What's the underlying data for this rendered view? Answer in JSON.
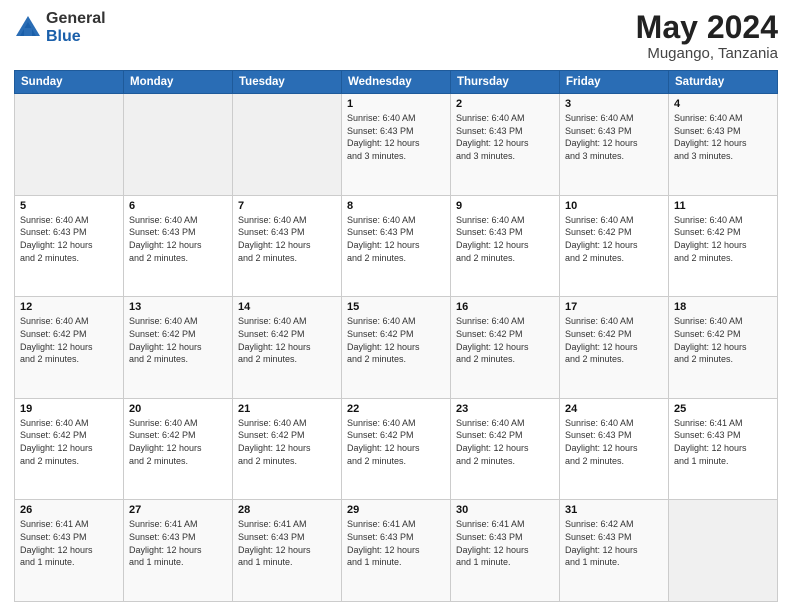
{
  "header": {
    "logo_general": "General",
    "logo_blue": "Blue",
    "month_title": "May 2024",
    "location": "Mugango, Tanzania"
  },
  "days_of_week": [
    "Sunday",
    "Monday",
    "Tuesday",
    "Wednesday",
    "Thursday",
    "Friday",
    "Saturday"
  ],
  "weeks": [
    [
      {
        "num": "",
        "info": ""
      },
      {
        "num": "",
        "info": ""
      },
      {
        "num": "",
        "info": ""
      },
      {
        "num": "1",
        "info": "Sunrise: 6:40 AM\nSunset: 6:43 PM\nDaylight: 12 hours\nand 3 minutes."
      },
      {
        "num": "2",
        "info": "Sunrise: 6:40 AM\nSunset: 6:43 PM\nDaylight: 12 hours\nand 3 minutes."
      },
      {
        "num": "3",
        "info": "Sunrise: 6:40 AM\nSunset: 6:43 PM\nDaylight: 12 hours\nand 3 minutes."
      },
      {
        "num": "4",
        "info": "Sunrise: 6:40 AM\nSunset: 6:43 PM\nDaylight: 12 hours\nand 3 minutes."
      }
    ],
    [
      {
        "num": "5",
        "info": "Sunrise: 6:40 AM\nSunset: 6:43 PM\nDaylight: 12 hours\nand 2 minutes."
      },
      {
        "num": "6",
        "info": "Sunrise: 6:40 AM\nSunset: 6:43 PM\nDaylight: 12 hours\nand 2 minutes."
      },
      {
        "num": "7",
        "info": "Sunrise: 6:40 AM\nSunset: 6:43 PM\nDaylight: 12 hours\nand 2 minutes."
      },
      {
        "num": "8",
        "info": "Sunrise: 6:40 AM\nSunset: 6:43 PM\nDaylight: 12 hours\nand 2 minutes."
      },
      {
        "num": "9",
        "info": "Sunrise: 6:40 AM\nSunset: 6:43 PM\nDaylight: 12 hours\nand 2 minutes."
      },
      {
        "num": "10",
        "info": "Sunrise: 6:40 AM\nSunset: 6:42 PM\nDaylight: 12 hours\nand 2 minutes."
      },
      {
        "num": "11",
        "info": "Sunrise: 6:40 AM\nSunset: 6:42 PM\nDaylight: 12 hours\nand 2 minutes."
      }
    ],
    [
      {
        "num": "12",
        "info": "Sunrise: 6:40 AM\nSunset: 6:42 PM\nDaylight: 12 hours\nand 2 minutes."
      },
      {
        "num": "13",
        "info": "Sunrise: 6:40 AM\nSunset: 6:42 PM\nDaylight: 12 hours\nand 2 minutes."
      },
      {
        "num": "14",
        "info": "Sunrise: 6:40 AM\nSunset: 6:42 PM\nDaylight: 12 hours\nand 2 minutes."
      },
      {
        "num": "15",
        "info": "Sunrise: 6:40 AM\nSunset: 6:42 PM\nDaylight: 12 hours\nand 2 minutes."
      },
      {
        "num": "16",
        "info": "Sunrise: 6:40 AM\nSunset: 6:42 PM\nDaylight: 12 hours\nand 2 minutes."
      },
      {
        "num": "17",
        "info": "Sunrise: 6:40 AM\nSunset: 6:42 PM\nDaylight: 12 hours\nand 2 minutes."
      },
      {
        "num": "18",
        "info": "Sunrise: 6:40 AM\nSunset: 6:42 PM\nDaylight: 12 hours\nand 2 minutes."
      }
    ],
    [
      {
        "num": "19",
        "info": "Sunrise: 6:40 AM\nSunset: 6:42 PM\nDaylight: 12 hours\nand 2 minutes."
      },
      {
        "num": "20",
        "info": "Sunrise: 6:40 AM\nSunset: 6:42 PM\nDaylight: 12 hours\nand 2 minutes."
      },
      {
        "num": "21",
        "info": "Sunrise: 6:40 AM\nSunset: 6:42 PM\nDaylight: 12 hours\nand 2 minutes."
      },
      {
        "num": "22",
        "info": "Sunrise: 6:40 AM\nSunset: 6:42 PM\nDaylight: 12 hours\nand 2 minutes."
      },
      {
        "num": "23",
        "info": "Sunrise: 6:40 AM\nSunset: 6:42 PM\nDaylight: 12 hours\nand 2 minutes."
      },
      {
        "num": "24",
        "info": "Sunrise: 6:40 AM\nSunset: 6:43 PM\nDaylight: 12 hours\nand 2 minutes."
      },
      {
        "num": "25",
        "info": "Sunrise: 6:41 AM\nSunset: 6:43 PM\nDaylight: 12 hours\nand 1 minute."
      }
    ],
    [
      {
        "num": "26",
        "info": "Sunrise: 6:41 AM\nSunset: 6:43 PM\nDaylight: 12 hours\nand 1 minute."
      },
      {
        "num": "27",
        "info": "Sunrise: 6:41 AM\nSunset: 6:43 PM\nDaylight: 12 hours\nand 1 minute."
      },
      {
        "num": "28",
        "info": "Sunrise: 6:41 AM\nSunset: 6:43 PM\nDaylight: 12 hours\nand 1 minute."
      },
      {
        "num": "29",
        "info": "Sunrise: 6:41 AM\nSunset: 6:43 PM\nDaylight: 12 hours\nand 1 minute."
      },
      {
        "num": "30",
        "info": "Sunrise: 6:41 AM\nSunset: 6:43 PM\nDaylight: 12 hours\nand 1 minute."
      },
      {
        "num": "31",
        "info": "Sunrise: 6:42 AM\nSunset: 6:43 PM\nDaylight: 12 hours\nand 1 minute."
      },
      {
        "num": "",
        "info": ""
      }
    ]
  ]
}
